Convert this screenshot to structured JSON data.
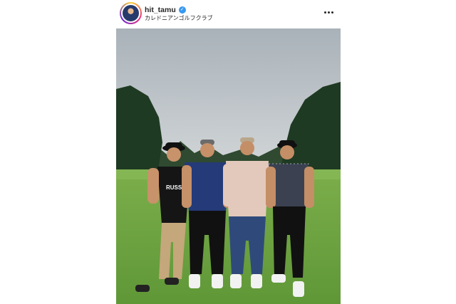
{
  "post": {
    "username": "hit_tamu",
    "verified_icon": "verified-badge-icon",
    "location": "カレドニアンゴルフクラブ",
    "more_icon": "more-options-icon"
  },
  "photo": {
    "shirt_text": "RUSSELL",
    "colors": {
      "sky": "#b9c0c6",
      "grass": "#6fa342",
      "trees": "#1f3a22"
    }
  }
}
